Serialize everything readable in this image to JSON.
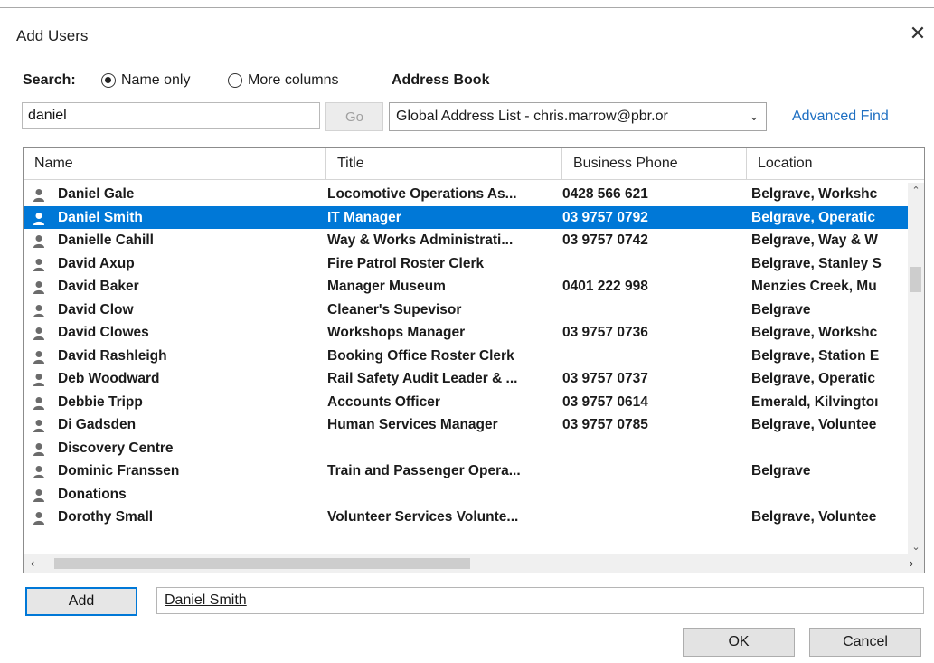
{
  "window": {
    "title": "Add Users",
    "close_glyph": "✕"
  },
  "search": {
    "label": "Search:",
    "options": [
      {
        "label": "Name only",
        "selected": true
      },
      {
        "label": "More columns",
        "selected": false
      }
    ],
    "query": "daniel",
    "go_label": "Go"
  },
  "address_book": {
    "label": "Address Book",
    "selected": "Global Address List - chris.marrow@pbr.or",
    "advanced_find": "Advanced Find"
  },
  "list": {
    "columns": [
      "Name",
      "Title",
      "Business Phone",
      "Location"
    ],
    "rows": [
      {
        "name": "Daniel Gale",
        "title": "Locomotive Operations As...",
        "phone": "0428 566 621",
        "location": "Belgrave, Workshc",
        "selected": false
      },
      {
        "name": "Daniel Smith",
        "title": "IT Manager",
        "phone": "03 9757 0792",
        "location": "Belgrave, Operatic",
        "selected": true
      },
      {
        "name": "Danielle Cahill",
        "title": "Way & Works Administrati...",
        "phone": "03 9757 0742",
        "location": "Belgrave, Way & W",
        "selected": false
      },
      {
        "name": "David Axup",
        "title": "Fire Patrol Roster Clerk",
        "phone": "",
        "location": "Belgrave, Stanley S",
        "selected": false
      },
      {
        "name": "David Baker",
        "title": "Manager Museum",
        "phone": "0401 222 998",
        "location": "Menzies Creek, Mu",
        "selected": false
      },
      {
        "name": "David Clow",
        "title": "Cleaner's Supevisor",
        "phone": "",
        "location": "Belgrave",
        "selected": false
      },
      {
        "name": "David Clowes",
        "title": "Workshops Manager",
        "phone": "03 9757 0736",
        "location": "Belgrave, Workshc",
        "selected": false
      },
      {
        "name": "David Rashleigh",
        "title": "Booking Office Roster Clerk",
        "phone": "",
        "location": "Belgrave, Station E",
        "selected": false
      },
      {
        "name": "Deb Woodward",
        "title": "Rail Safety Audit Leader & ...",
        "phone": "03 9757 0737",
        "location": "Belgrave, Operatic",
        "selected": false
      },
      {
        "name": "Debbie Tripp",
        "title": "Accounts Officer",
        "phone": "03 9757 0614",
        "location": "Emerald, Kilvingtoı",
        "selected": false
      },
      {
        "name": "Di Gadsden",
        "title": "Human Services Manager",
        "phone": "03 9757 0785",
        "location": "Belgrave, Voluntee",
        "selected": false
      },
      {
        "name": "Discovery Centre",
        "title": "",
        "phone": "",
        "location": "",
        "selected": false
      },
      {
        "name": "Dominic Franssen",
        "title": "Train and Passenger Opera...",
        "phone": "",
        "location": "Belgrave",
        "selected": false
      },
      {
        "name": "Donations",
        "title": "",
        "phone": "",
        "location": "",
        "selected": false
      },
      {
        "name": "Dorothy Small",
        "title": "Volunteer Services Volunte...",
        "phone": "",
        "location": "Belgrave, Voluntee",
        "selected": false
      }
    ]
  },
  "add": {
    "button_label": "Add",
    "value": "Daniel Smith"
  },
  "footer": {
    "ok_label": "OK",
    "cancel_label": "Cancel"
  },
  "icons": {
    "user": "user-icon"
  },
  "colors": {
    "selection": "#0078d7",
    "link": "#1e6fc2"
  }
}
